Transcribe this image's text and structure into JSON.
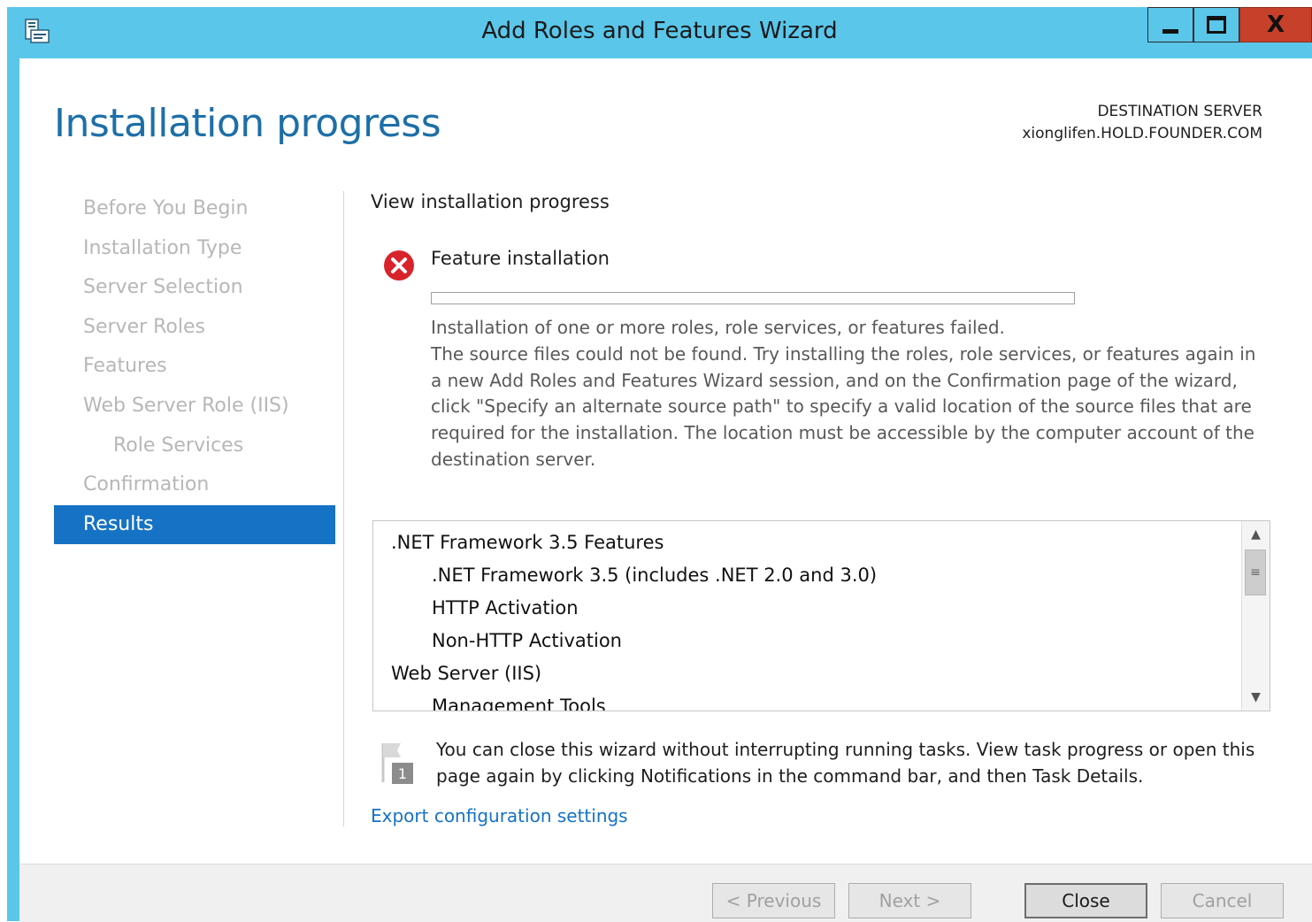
{
  "window": {
    "title": "Add Roles and Features Wizard",
    "controls": {
      "minimize": "minimize",
      "maximize": "maximize",
      "close": "X"
    }
  },
  "header": {
    "page_title": "Installation progress",
    "destination_label": "DESTINATION SERVER",
    "destination_server": "xionglifen.HOLD.FOUNDER.COM"
  },
  "nav": {
    "items": [
      {
        "label": "Before You Begin",
        "state": "disabled"
      },
      {
        "label": "Installation Type",
        "state": "disabled"
      },
      {
        "label": "Server Selection",
        "state": "disabled"
      },
      {
        "label": "Server Roles",
        "state": "disabled"
      },
      {
        "label": "Features",
        "state": "disabled"
      },
      {
        "label": "Web Server Role (IIS)",
        "state": "disabled"
      },
      {
        "label": "Role Services",
        "state": "disabled"
      },
      {
        "label": "Confirmation",
        "state": "disabled"
      },
      {
        "label": "Results",
        "state": "active"
      }
    ]
  },
  "main": {
    "heading": "View installation progress",
    "feature_label": "Feature installation",
    "status_icon": "error-circle-icon",
    "progress_value": 0,
    "message_line1": "Installation of one or more roles, role services, or features failed.",
    "message_line2": "The source files could not be found. Try installing the roles, role services, or features again in a new Add Roles and Features Wizard session, and on the Confirmation page of the wizard, click \"Specify an alternate source path\" to specify a valid location of the source files that are required for the installation. The location must be accessible by the computer account of the destination server.",
    "results_list": [
      {
        "text": ".NET Framework 3.5 Features",
        "level": 0
      },
      {
        "text": ".NET Framework 3.5 (includes .NET 2.0 and 3.0)",
        "level": 1
      },
      {
        "text": "HTTP Activation",
        "level": 1
      },
      {
        "text": "Non-HTTP Activation",
        "level": 1
      },
      {
        "text": "Web Server (IIS)",
        "level": 0
      },
      {
        "text": "Management Tools",
        "level": 1
      }
    ],
    "notice_text": "You can close this wizard without interrupting running tasks. View task progress or open this page again by clicking Notifications in the command bar, and then Task Details.",
    "notice_badge": "1",
    "export_link": "Export configuration settings"
  },
  "footer": {
    "previous": "< Previous",
    "next": "Next >",
    "close": "Close",
    "cancel": "Cancel"
  },
  "colors": {
    "titlebar": "#5ac6ea",
    "accent": "#1672c4",
    "error": "#d8232a",
    "close_button": "#c7402a"
  }
}
